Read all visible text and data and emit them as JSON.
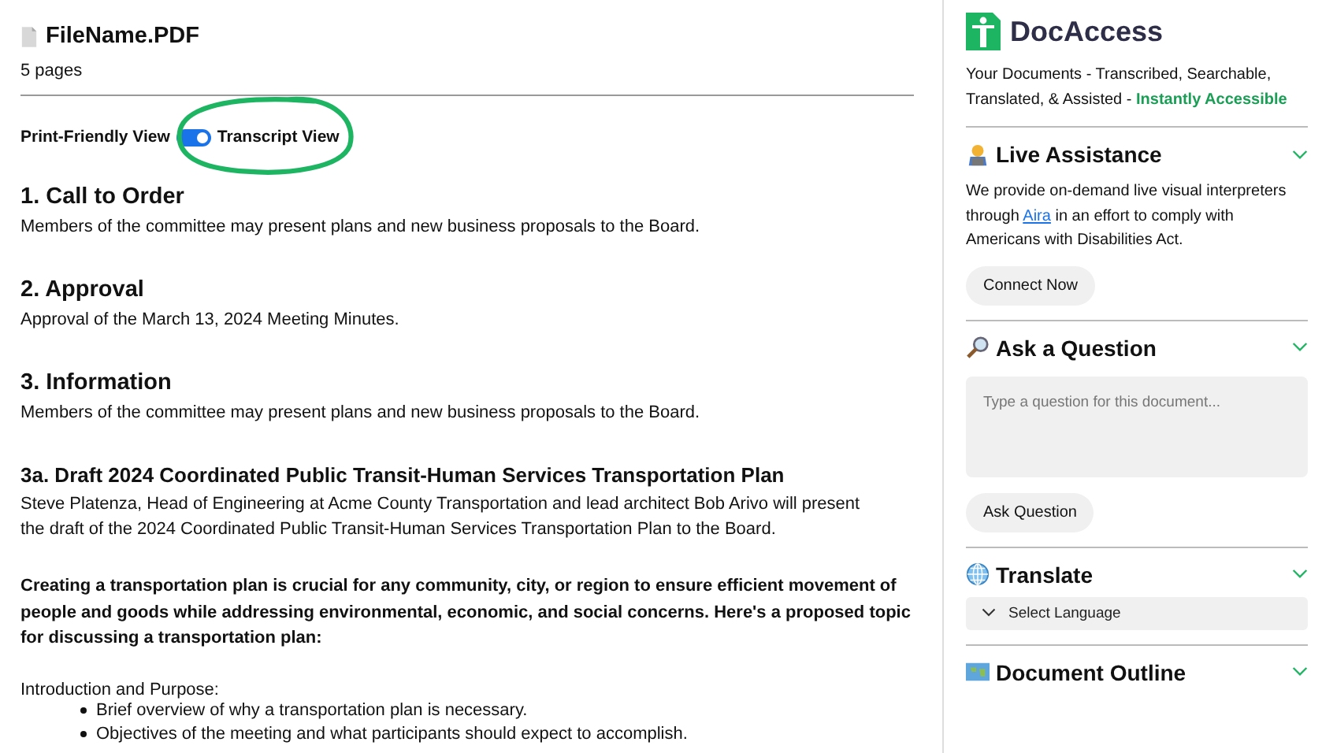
{
  "document": {
    "file_name": "FileName.PDF",
    "pages": "5 pages"
  },
  "view_toggle": {
    "left_label": "Print-Friendly View",
    "right_label": "Transcript View",
    "on": true,
    "highlighted": true
  },
  "sections": [
    {
      "heading": "1. Call to Order",
      "body": "Members of the committee may present plans and new business proposals to the Board."
    },
    {
      "heading": "2. Approval",
      "body": "Approval of the March 13, 2024 Meeting Minutes."
    },
    {
      "heading": "3. Information",
      "body": "Members of the committee may present plans and new business proposals to the Board."
    },
    {
      "heading": "3a. Draft 2024 Coordinated Public Transit-Human Services Transportation Plan",
      "body": "Steve Platenza, Head of Engineering at Acme County Transportation and lead architect Bob Arivo will present the draft of the 2024 Coordinated Public Transit-Human Services Transportation Plan to the Board."
    }
  ],
  "intro": "Creating a transportation plan is crucial for any community, city, or region to ensure efficient movement of people and goods while addressing environmental, economic, and social concerns. Here's a proposed topic for discussing a transportation plan:",
  "topic": {
    "title": "Introduction and Purpose:",
    "bullets": [
      "Brief overview of why a transportation plan is necessary.",
      "Objectives of the meeting and what participants should expect to accomplish."
    ]
  },
  "sidebar": {
    "brand": "DocAccess",
    "tagline": "Your Documents - Transcribed, Searchable, Translated, & Assisted - ",
    "tagline_accent": "Instantly Accessible",
    "panels": [
      {
        "kind": "assist",
        "title": "Live Assistance",
        "text_before": "We provide on-demand live visual interpreters through ",
        "link": "Aira",
        "text_after": " in an effort to comply with Americans with Disabilities Act.",
        "button": "Connect Now"
      },
      {
        "kind": "ask",
        "title": "Ask a Question",
        "placeholder": "Type a question for this document...",
        "button": "Ask Question"
      },
      {
        "kind": "translate",
        "title": "Translate",
        "select": "Select Language"
      },
      {
        "kind": "outline",
        "title": "Document Outline"
      }
    ]
  }
}
